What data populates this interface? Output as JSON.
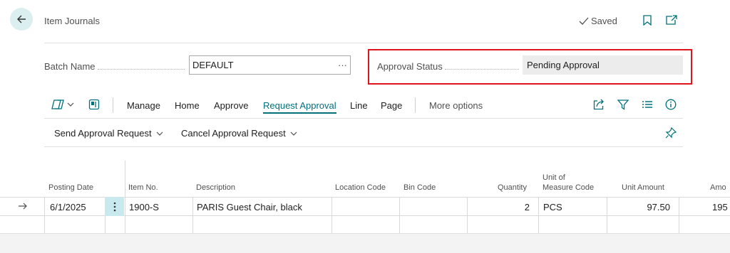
{
  "header": {
    "title": "Item Journals",
    "saved_label": "Saved"
  },
  "fields": {
    "batch_name_label": "Batch Name",
    "batch_name_value": "DEFAULT",
    "batch_lookup": "···",
    "approval_status_label": "Approval Status",
    "approval_status_value": "Pending Approval"
  },
  "actions": {
    "items": [
      "Manage",
      "Home",
      "Approve",
      "Request Approval",
      "Line",
      "Page"
    ],
    "active": "Request Approval",
    "more_options": "More options"
  },
  "sub_actions": {
    "send": "Send Approval Request",
    "cancel": "Cancel Approval Request"
  },
  "table": {
    "columns": {
      "posting_date": "Posting Date",
      "item_no": "Item No.",
      "description": "Description",
      "location_code": "Location Code",
      "bin_code": "Bin Code",
      "quantity": "Quantity",
      "uom_line1": "Unit of",
      "uom_line2": "Measure Code",
      "unit_amount": "Unit Amount",
      "amount": "Amo"
    },
    "row": {
      "posting_date": "6/1/2025",
      "item_no": "1900-S",
      "description": "PARIS Guest Chair, black",
      "location_code": "",
      "bin_code": "",
      "quantity": "2",
      "uom": "PCS",
      "unit_amount": "97.50",
      "amount": "195"
    }
  },
  "colors": {
    "accent": "#00707a",
    "highlight_border": "#e0141b",
    "status_bg": "#ececec"
  },
  "icons": [
    "back-arrow-icon",
    "checkmark-icon",
    "bookmark-icon",
    "open-new-window-icon",
    "copilot-icon",
    "chevron-down-icon",
    "layout-icon",
    "share-icon",
    "filter-icon",
    "list-icon",
    "info-icon",
    "pin-icon",
    "row-arrow-icon",
    "row-menu-icon"
  ]
}
